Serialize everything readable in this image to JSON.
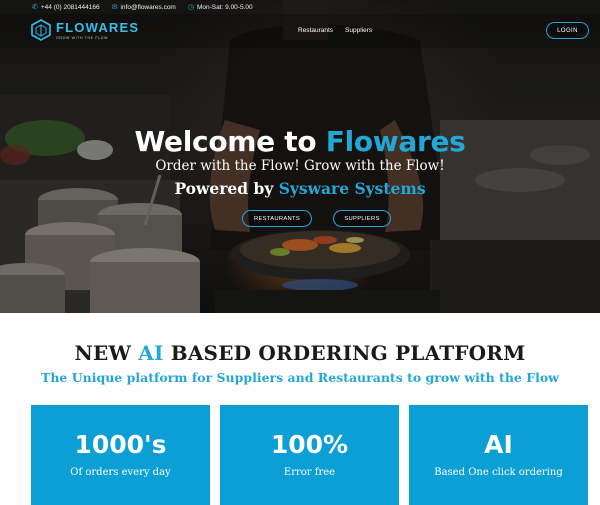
{
  "topbar": {
    "phone": "+44 (0) 2081444166",
    "email": "info@flowares.com",
    "hours": "Mon-Sat: 9.00-5.00"
  },
  "brand": {
    "name": "FLOWARES",
    "tagline": "GROW WITH THE FLOW"
  },
  "nav": {
    "items": [
      "Restaurants",
      "Suppliers"
    ],
    "login_label": "LOGIN"
  },
  "hero": {
    "title_prefix": "Welcome to ",
    "title_accent": "Flowares",
    "subtitle": "Order with the Flow! Grow with the Flow!",
    "powered_prefix": "Powered by ",
    "powered_accent": "Sysware Systems",
    "buttons": [
      "RESTAURANTS",
      "SUPPLIERS"
    ]
  },
  "platform": {
    "title_prefix": "NEW ",
    "title_accent": "AI",
    "title_suffix": " BASED ORDERING PLATFORM",
    "subtitle": "The Unique platform for Suppliers and Restaurants to grow with the Flow",
    "cards": [
      {
        "value": "1000's",
        "label": "Of orders every day"
      },
      {
        "value": "100%",
        "label": "Error free"
      },
      {
        "value": "AI",
        "label": "Based One click ordering"
      }
    ]
  },
  "colors": {
    "accent": "#22a7d6",
    "card_bg": "#0c9fd6"
  },
  "icons": {
    "phone": "phone-icon",
    "email": "envelope-icon",
    "hours": "clock-icon"
  }
}
